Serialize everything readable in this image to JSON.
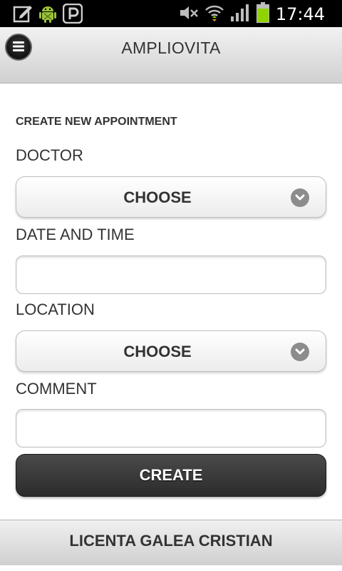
{
  "status_bar": {
    "time": "17:44",
    "left_icons": [
      "edit-icon",
      "android-debug-icon",
      "p-app-icon"
    ],
    "right_icons": [
      "no-sound-icon",
      "wifi-icon",
      "signal-icon",
      "battery-icon"
    ]
  },
  "header": {
    "title": "AMPLIOVITA",
    "menu_icon": "menu-icon"
  },
  "form": {
    "section_title": "CREATE NEW APPOINTMENT",
    "doctor": {
      "label": "DOCTOR",
      "selected": "CHOOSE"
    },
    "date_time": {
      "label": "DATE AND TIME",
      "value": ""
    },
    "location": {
      "label": "LOCATION",
      "selected": "CHOOSE"
    },
    "comment": {
      "label": "COMMENT",
      "value": ""
    },
    "create_label": "CREATE"
  },
  "footer": {
    "text": "LICENTA GALEA CRISTIAN"
  },
  "colors": {
    "status_bar_bg": "#000000",
    "header_bg": "#dcdcdc",
    "button_dark": "#333333",
    "battery_green": "#8fd400",
    "text": "#333333"
  }
}
